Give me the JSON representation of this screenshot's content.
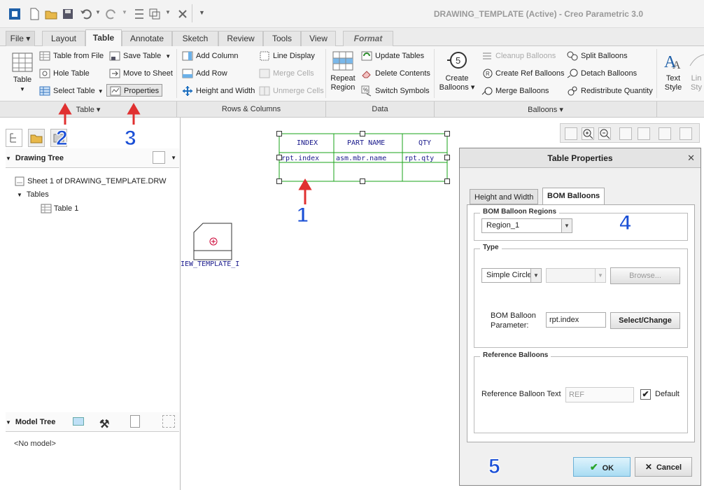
{
  "window": {
    "title": "DRAWING_TEMPLATE (Active) - Creo Parametric 3.0"
  },
  "tabs": [
    {
      "label": "File ▾"
    },
    {
      "label": "Layout"
    },
    {
      "label": "Table"
    },
    {
      "label": "Annotate"
    },
    {
      "label": "Sketch"
    },
    {
      "label": "Review"
    },
    {
      "label": "Tools"
    },
    {
      "label": "View"
    },
    {
      "label": "Format"
    }
  ],
  "ribbon": {
    "table_btn": "Table",
    "table_from_file": "Table from File",
    "hole_table": "Hole Table",
    "select_table": "Select Table",
    "save_table": "Save Table",
    "move_to_sheet": "Move to Sheet",
    "properties": "Properties",
    "add_column": "Add Column",
    "add_row": "Add Row",
    "height_width": "Height and Width",
    "line_display": "Line Display",
    "merge_cells": "Merge Cells",
    "unmerge_cells": "Unmerge Cells",
    "repeat_region_1": "Repeat",
    "repeat_region_2": "Region",
    "update_tables": "Update Tables",
    "delete_contents": "Delete Contents",
    "switch_symbols": "Switch Symbols",
    "create_balloons_1": "Create",
    "create_balloons_2": "Balloons ▾",
    "cleanup_balloons": "Cleanup Balloons",
    "create_ref_balloons": "Create Ref Balloons",
    "merge_balloons": "Merge Balloons",
    "split_balloons": "Split Balloons",
    "detach_balloons": "Detach Balloons",
    "redistribute_quantity": "Redistribute Quantity",
    "text_style_1": "Text",
    "text_style_2": "Style",
    "line_style_1": "Lin",
    "line_style_2": "Sty"
  },
  "groups": {
    "table": "Table ▾",
    "rows_columns": "Rows & Columns",
    "data": "Data",
    "balloons": "Balloons ▾"
  },
  "drawing_tree": {
    "header": "Drawing Tree",
    "sheet": "Sheet 1 of DRAWING_TEMPLATE.DRW",
    "tables": "Tables",
    "table1": "Table 1"
  },
  "model_tree": {
    "header": "Model Tree",
    "empty": "<No model>"
  },
  "drawing": {
    "headers": [
      "INDEX",
      "PART NAME",
      "QTY"
    ],
    "params": [
      "rpt.index",
      "asm.mbr.name",
      "rpt.qty"
    ],
    "view_label": "IEW_TEMPLATE_I"
  },
  "dialog": {
    "title": "Table Properties",
    "tab_height": "Height and Width",
    "tab_bom": "BOM Balloons",
    "regions_label": "BOM Balloon Regions",
    "region_value": "Region_1",
    "type_label": "Type",
    "type_value": "Simple Circle",
    "browse": "Browse...",
    "param_label_1": "BOM Balloon",
    "param_label_2": "Parameter:",
    "param_value": "rpt.index",
    "select_change": "Select/Change",
    "ref_section": "Reference Balloons",
    "ref_text_label": "Reference Balloon Text",
    "ref_text_value": "REF",
    "default_label": "Default",
    "ok": "OK",
    "cancel": "Cancel"
  },
  "annotations": [
    "1",
    "2",
    "3",
    "4",
    "5"
  ],
  "colors": {
    "accent": "#1a4fd6",
    "arrow": "#e03030",
    "table_line": "#1aa31a",
    "ok_btn": "#bfe6f7"
  }
}
